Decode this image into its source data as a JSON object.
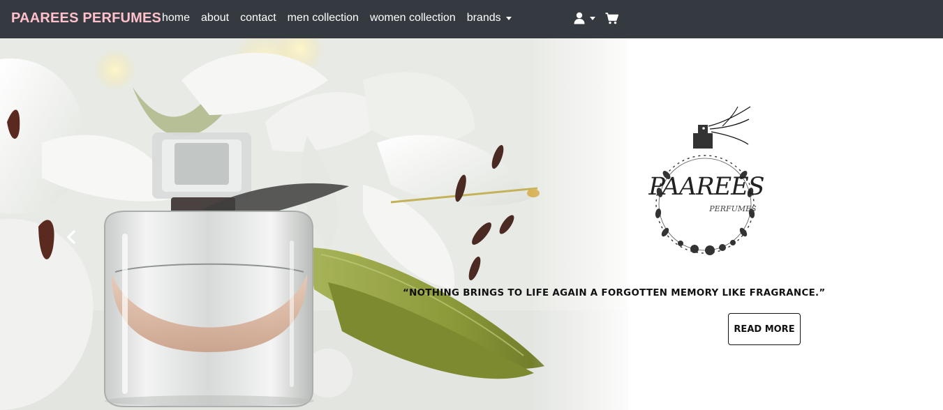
{
  "navbar": {
    "brand": "PAAREES PERFUMES",
    "links": [
      {
        "label": "home"
      },
      {
        "label": "about"
      },
      {
        "label": "contact"
      },
      {
        "label": "men collection"
      },
      {
        "label": "women collection"
      },
      {
        "label": "brands"
      }
    ],
    "user_icon": "user-icon",
    "cart_icon": "cart-icon",
    "bg_color": "#343a40",
    "brand_color": "#ffc0cb"
  },
  "hero": {
    "logo": {
      "wordmark": "PAAREES",
      "tagline": "PERFUMES"
    },
    "quote": "“NOTHING BRINGS TO LIFE AGAIN A FORGOTTEN MEMORY LIKE FRAGRANCE.”",
    "cta_label": "READ MORE",
    "prev_icon": "chevron-left-icon"
  }
}
